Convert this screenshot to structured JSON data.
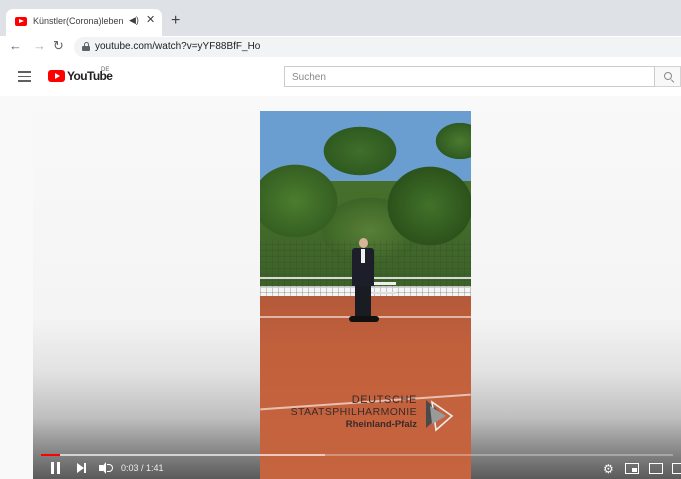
{
  "browser": {
    "tab": {
      "title": "Künstler(Corona)leben | Deutsche Staatsphilharmonie"
    },
    "new_tab_label": "+",
    "address_bar": {
      "url": "youtube.com/watch?v=yYF88BfF_Ho"
    }
  },
  "youtube": {
    "logo_text": "YouTube",
    "region": "DE",
    "search": {
      "placeholder": "Suchen",
      "value": ""
    }
  },
  "video": {
    "overlay_logo": {
      "line1": "DEUTSCHE",
      "line2": "STAATSPHILHARMONIE",
      "line3": "Rheinland-Pfalz"
    },
    "player": {
      "current_time": "0:03",
      "duration": "1:41",
      "time_display": "0:03 / 1:41",
      "progress_fraction": 0.03,
      "buffered_fraction": 0.45
    }
  },
  "icons": [
    "youtube-favicon-icon",
    "audio-playing-icon",
    "close-icon",
    "back-arrow-icon",
    "forward-arrow-icon",
    "reload-icon",
    "lock-icon",
    "hamburger-menu-icon",
    "search-icon",
    "pause-icon",
    "next-icon",
    "volume-icon",
    "settings-gear-icon",
    "miniplayer-icon",
    "theater-mode-icon",
    "fullscreen-icon"
  ],
  "colors": {
    "youtube_red": "#ff0000",
    "tab_strip": "#dee1e6",
    "omnibox": "#f1f3f4"
  }
}
